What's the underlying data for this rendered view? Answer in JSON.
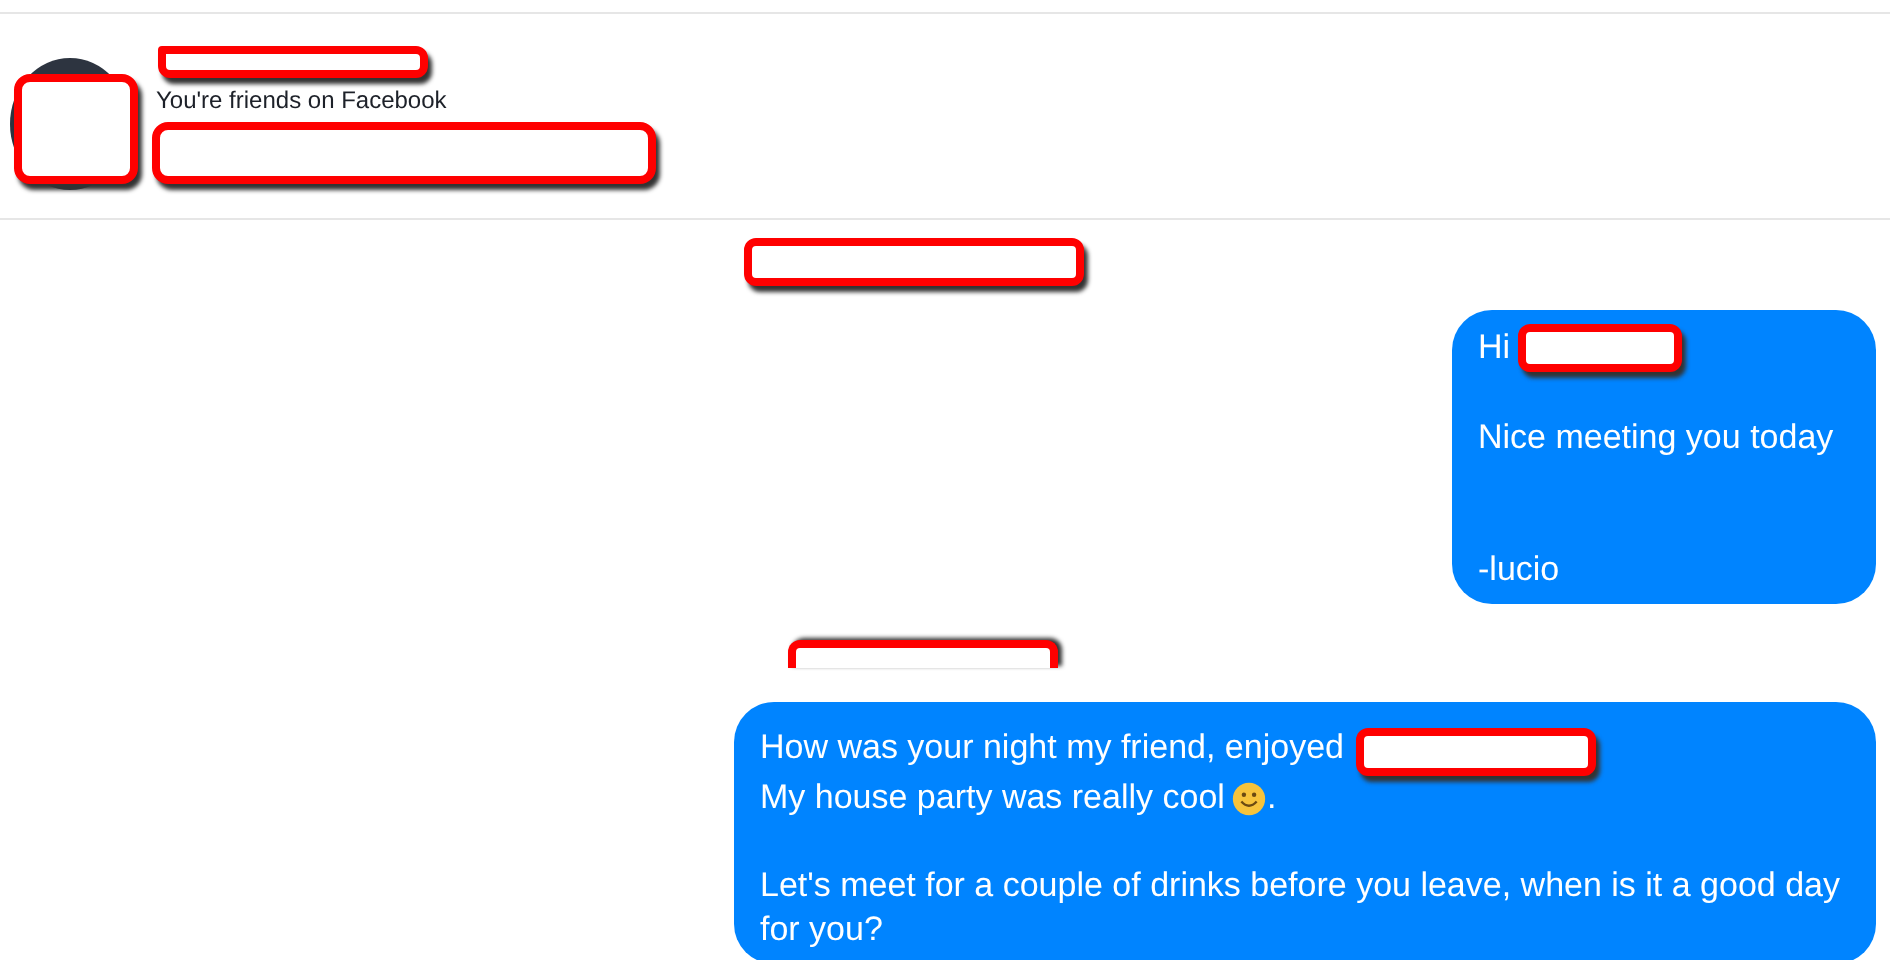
{
  "header": {
    "avatar": {
      "kind": "redaction"
    },
    "lines": [
      {
        "kind": "redaction"
      },
      {
        "kind": "text",
        "text": "You're friends on Facebook"
      },
      {
        "kind": "redaction"
      }
    ]
  },
  "conversation": [
    {
      "kind": "redaction"
    },
    {
      "kind": "message",
      "lines": [
        {
          "kind": "text",
          "parts": [
            {
              "kind": "text",
              "text": "Hi"
            },
            {
              "kind": "redaction"
            }
          ]
        },
        {
          "kind": "blank"
        },
        {
          "kind": "text",
          "parts": [
            {
              "kind": "text",
              "text": "Nice meeting you today"
            }
          ]
        },
        {
          "kind": "blank"
        },
        {
          "kind": "blank"
        },
        {
          "kind": "text",
          "parts": [
            {
              "kind": "text",
              "text": "-lucio"
            }
          ]
        }
      ]
    },
    {
      "kind": "redaction"
    },
    {
      "kind": "message",
      "lines": [
        {
          "kind": "text",
          "parts": [
            {
              "kind": "text",
              "text": "How was your night my friend, enjoyed"
            },
            {
              "kind": "redaction"
            }
          ]
        },
        {
          "kind": "text",
          "parts": [
            {
              "kind": "text",
              "text": "My house party was really cool"
            },
            {
              "kind": "emoji"
            },
            {
              "kind": "text",
              "text": "."
            }
          ]
        },
        {
          "kind": "blank"
        },
        {
          "kind": "text",
          "parts": [
            {
              "kind": "text",
              "text": "Let's meet for a couple of drinks before you leave, when is it a good day for you?"
            }
          ]
        }
      ]
    }
  ]
}
